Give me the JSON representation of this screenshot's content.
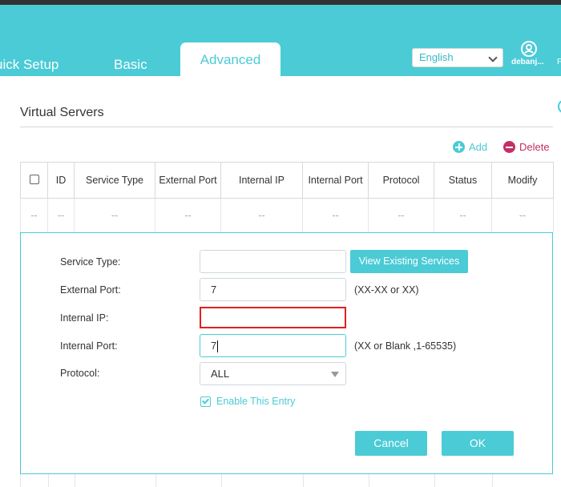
{
  "colors": {
    "accent": "#4acbd6",
    "delete": "#c32f66",
    "error": "#e02020"
  },
  "nav": {
    "tabs": [
      {
        "label": "uick Setup"
      },
      {
        "label": "Basic"
      },
      {
        "label": "Advanced",
        "active": true
      }
    ],
    "language": "English",
    "user": {
      "name": "debanj...",
      "extra": "F",
      "icon": "user-icon"
    }
  },
  "page": {
    "title": "Virtual Servers"
  },
  "toolbar": {
    "add_label": "Add",
    "delete_label": "Delete"
  },
  "table": {
    "columns": [
      "ID",
      "Service Type",
      "External Port",
      "Internal IP",
      "Internal Port",
      "Protocol",
      "Status",
      "Modify"
    ],
    "placeholder_row": [
      "--",
      "--",
      "--",
      "--",
      "--",
      "--",
      "--",
      "--",
      "--"
    ]
  },
  "form": {
    "service_type": {
      "label": "Service Type:",
      "value": ""
    },
    "view_existing_label": "View Existing Services",
    "external_port": {
      "label": "External Port:",
      "value": "7",
      "hint": "(XX-XX or XX)"
    },
    "internal_ip": {
      "label": "Internal IP:",
      "value": ""
    },
    "internal_port": {
      "label": "Internal Port:",
      "value": "7",
      "hint": "(XX or Blank ,1-65535)"
    },
    "protocol": {
      "label": "Protocol:",
      "value": "ALL"
    },
    "enable_label": "Enable This Entry",
    "enable_checked": true,
    "cancel_label": "Cancel",
    "ok_label": "OK"
  }
}
